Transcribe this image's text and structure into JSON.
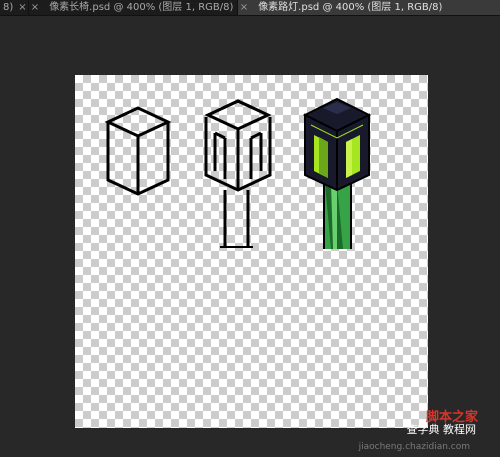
{
  "tabs": [
    {
      "label": "8)",
      "close": "×"
    },
    {
      "label": "像素长椅.psd @ 400% (图层 1, RGB/8)",
      "close": "×"
    },
    {
      "label": "像素路灯.psd @ 400% (图层 1, RGB/8)",
      "close": "×",
      "active": true
    }
  ],
  "watermark": {
    "logo": "脚本之家",
    "subtitle": "查字典 教程网",
    "url": "jiaocheng.chazidian.com"
  },
  "colors": {
    "workspace_bg": "#282828",
    "outline": "#000000",
    "lamp_dark": "#181a2c",
    "lamp_lit": "#a6e621",
    "lamp_lit_shade": "#6aa81a",
    "pole_green": "#35a346",
    "pole_dark": "#1d6b2a"
  },
  "icons": [
    "close-icon",
    "close-icon",
    "close-icon"
  ]
}
